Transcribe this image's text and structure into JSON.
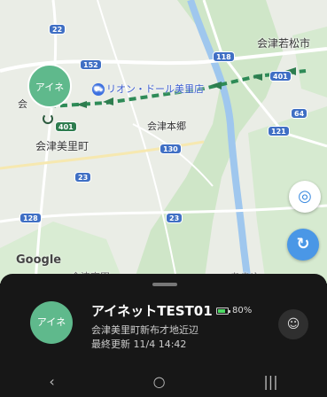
{
  "map": {
    "places": {
      "aizu_wakamatsu": "会津若松市",
      "aizu_hongo": "会津本郷",
      "aizu_misato": "会津美里町",
      "aizu_short": "会",
      "partial_bottom_left": "会津高田",
      "partial_bottom_right": "あまゆ"
    },
    "poi": {
      "icon": "shopping-cart-icon",
      "name": "リオン・ドール美里店"
    },
    "routes": {
      "r22": "22",
      "r152": "152",
      "r118": "118",
      "r401a": "401",
      "r401b": "401",
      "r64": "64",
      "r121": "121",
      "r130": "130",
      "r23a": "23",
      "r23b": "23",
      "r128": "128"
    },
    "marker_label": "アイネ",
    "google_logo": "Google",
    "locate_icon": "crosshair-icon",
    "refresh_icon": "refresh-icon",
    "locate_glyph": "◎",
    "refresh_glyph": "↻",
    "colors": {
      "route_line": "#2e8b57",
      "accent_blue": "#4a97e6",
      "marker_green": "#5fb98c"
    }
  },
  "sheet": {
    "avatar_label": "アイネ",
    "device_name": "アイネットTEST01",
    "battery_pct": "80%",
    "battery_level": 0.8,
    "address": "会津美里町新布才地近辺",
    "last_updated": "最終更新 11/4 14:42",
    "chat_icon": "chat-bubble-icon",
    "chat_glyph": "☺"
  },
  "navbar": {
    "back": "‹",
    "home": "○",
    "recents": "|||"
  }
}
